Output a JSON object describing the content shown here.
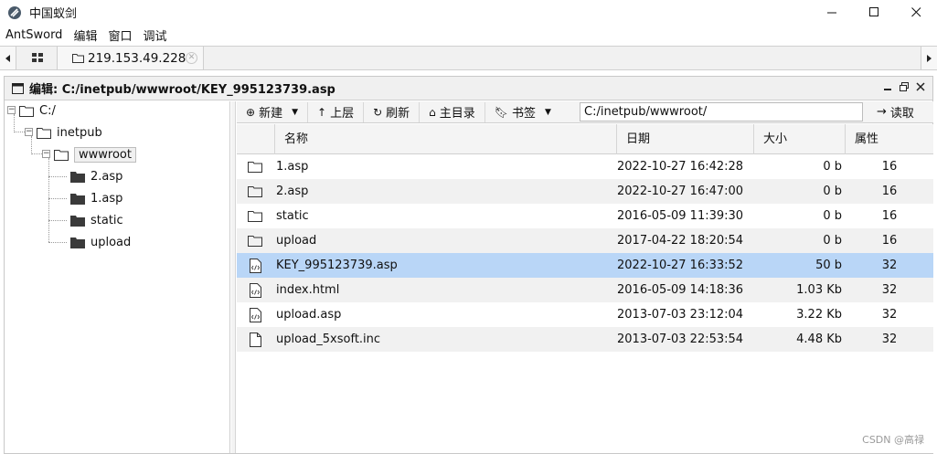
{
  "window": {
    "title": "中国蚁剑"
  },
  "menu": [
    "AntSword",
    "编辑",
    "窗口",
    "调试"
  ],
  "tabs": {
    "active_label": "219.153.49.228"
  },
  "panel": {
    "title": "编辑: C:/inetpub/wwwroot/KEY_995123739.asp"
  },
  "tree": {
    "root": "C:/",
    "inetpub": "inetpub",
    "wwwroot": "wwwroot",
    "children": [
      "2.asp",
      "1.asp",
      "static",
      "upload"
    ]
  },
  "toolbar": {
    "new_label": "新建",
    "up_label": "上层",
    "refresh_label": "刷新",
    "home_label": "主目录",
    "bookmark_label": "书签",
    "path_value": "C:/inetpub/wwwroot/",
    "read_label": "读取"
  },
  "grid": {
    "columns": [
      "名称",
      "日期",
      "大小",
      "属性"
    ],
    "rows": [
      {
        "type": "folder",
        "name": "1.asp",
        "date": "2022-10-27 16:42:28",
        "size": "0 b",
        "attr": "16"
      },
      {
        "type": "folder",
        "name": "2.asp",
        "date": "2022-10-27 16:47:00",
        "size": "0 b",
        "attr": "16"
      },
      {
        "type": "folder",
        "name": "static",
        "date": "2016-05-09 11:39:30",
        "size": "0 b",
        "attr": "16"
      },
      {
        "type": "folder",
        "name": "upload",
        "date": "2017-04-22 18:20:54",
        "size": "0 b",
        "attr": "16"
      },
      {
        "type": "code-file",
        "name": "KEY_995123739.asp",
        "date": "2022-10-27 16:33:52",
        "size": "50 b",
        "attr": "32"
      },
      {
        "type": "code-file",
        "name": "index.html",
        "date": "2016-05-09 14:18:36",
        "size": "1.03 Kb",
        "attr": "32"
      },
      {
        "type": "code-file",
        "name": "upload.asp",
        "date": "2013-07-03 23:12:04",
        "size": "3.22 Kb",
        "attr": "32"
      },
      {
        "type": "file",
        "name": "upload_5xsoft.inc",
        "date": "2013-07-03 22:53:54",
        "size": "4.48 Kb",
        "attr": "32"
      }
    ]
  },
  "colors": {
    "selected_row": "#b9d6f7",
    "alt_row": "#f1f1f1"
  },
  "watermark": "CSDN @高禄"
}
